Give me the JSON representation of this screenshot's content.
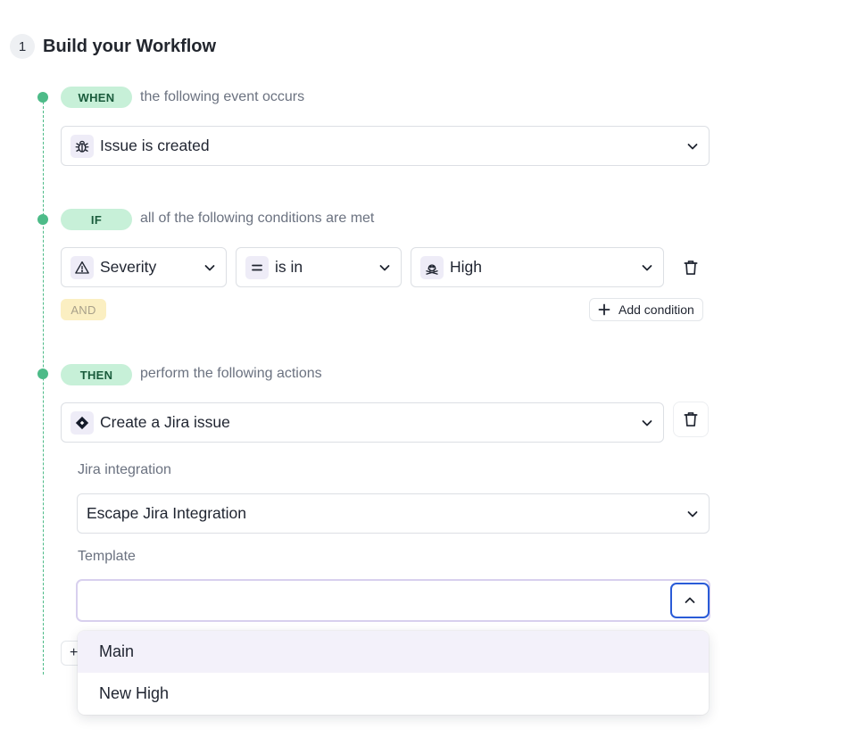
{
  "header": {
    "step_number": "1",
    "title": "Build your Workflow"
  },
  "when": {
    "pill": "WHEN",
    "description": "the following event occurs",
    "event_select": {
      "value": "Issue is created",
      "icon": "bug-icon"
    }
  },
  "if": {
    "pill": "IF",
    "description": "all of the following conditions are met",
    "condition": {
      "field": {
        "value": "Severity",
        "icon": "warning-triangle-icon"
      },
      "operator": {
        "value": "is in",
        "icon": "equals-icon"
      },
      "value": {
        "value": "High",
        "icon": "skull-icon"
      }
    },
    "and_label": "AND",
    "add_condition_label": "Add condition"
  },
  "then": {
    "pill": "THEN",
    "description": "perform the following actions",
    "action_select": {
      "value": "Create a Jira issue",
      "icon": "jira-diamond-icon"
    },
    "jira_integration_label": "Jira integration",
    "jira_integration_value": "Escape Jira Integration",
    "template_label": "Template",
    "template_value": "",
    "template_options": [
      {
        "label": "Main",
        "highlighted": true
      },
      {
        "label": "New High",
        "highlighted": false
      }
    ],
    "hidden_add_button_label": "+"
  },
  "colors": {
    "accent_green": "#4dbb88",
    "pill_green_bg": "#c7f0d8",
    "focus_blue": "#2a5bd7",
    "and_bg": "#fbefc2"
  }
}
